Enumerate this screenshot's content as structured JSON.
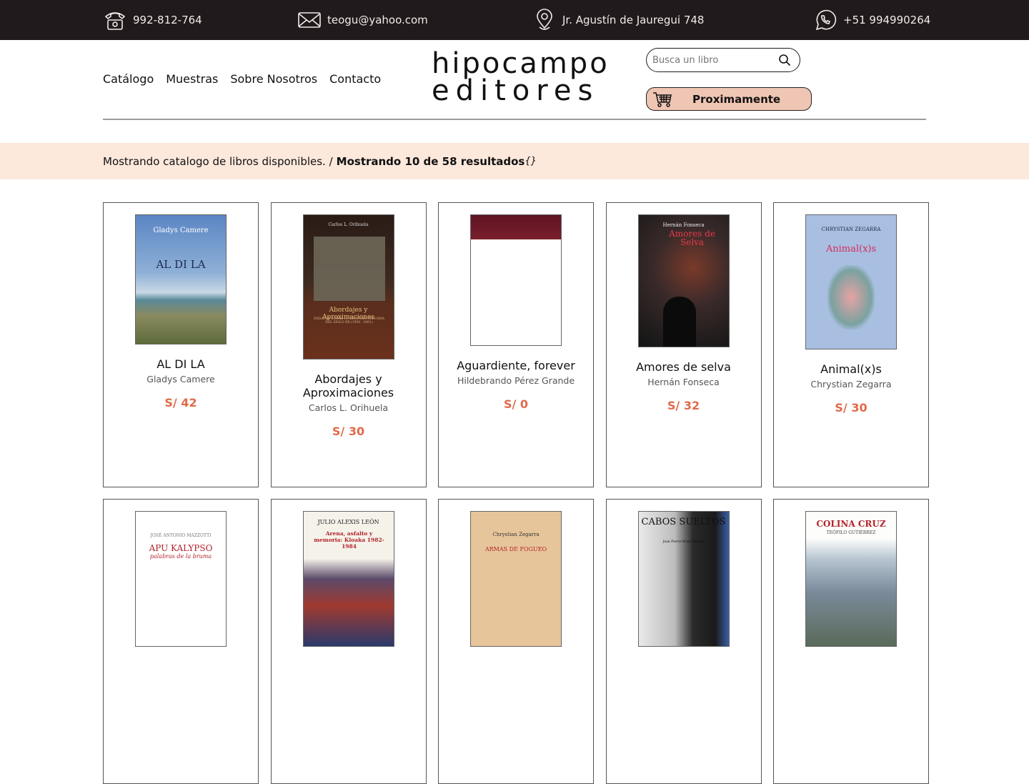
{
  "topbar": {
    "phone": "992-812-764",
    "email": "teogu@yahoo.com",
    "address": "Jr. Agustín de Jauregui 748",
    "whatsapp": "+51 994990264"
  },
  "nav": {
    "items": [
      "Catálogo",
      "Muestras",
      "Sobre Nosotros",
      "Contacto"
    ]
  },
  "logo": {
    "line1": "hipocampo",
    "line2": "editores"
  },
  "search": {
    "placeholder": "Busca un libro"
  },
  "cart": {
    "label": "Proximamente"
  },
  "strip": {
    "text": "Mostrando catalogo de libros disponibles. /",
    "count": "Mostrando 10 de 58 resultados",
    "suffix": "{}"
  },
  "books": [
    {
      "title": "AL DI LA",
      "author": "Gladys Camere",
      "price": "S/ 42",
      "cover_author": "Gladys Camere",
      "cover_title": "AL DI LA"
    },
    {
      "title": "Abordajes y Aproximaciones",
      "author": "Carlos L. Orihuela",
      "price": "S/ 30",
      "cover_author": "Carlos L. Orihuela",
      "cover_title": "Abordajes y Aproximaciones",
      "cover_sub": "ENSAYOS SOBRE LITERATURA PERUANA DEL SIGLO XX (1950 - 2001)"
    },
    {
      "title": "Aguardiente, forever",
      "author": "Hildebrando Pérez Grande",
      "price": "S/ 0"
    },
    {
      "title": "Amores de selva",
      "author": "Hernán Fonseca",
      "price": "S/ 32",
      "cover_author": "Hernán Fonseca",
      "cover_title": "Amores de Selva"
    },
    {
      "title": "Animal(x)s",
      "author": "Chrystian Zegarra",
      "price": "S/ 30",
      "cover_author": "CHRYSTIAN ZEGARRA",
      "cover_title": "Animal(x)s"
    },
    {
      "cover_author": "JOSÉ ANTONIO MAZZOTTI",
      "cover_title": "APU KALYPSO",
      "cover_sub": "palabras de la bruma"
    },
    {
      "cover_author": "JULIO ALEXIS LEÓN",
      "cover_title": "Arena, asfalto y memoria: Kloaka 1982-1984"
    },
    {
      "cover_author": "Chrystian Zegarra",
      "cover_title": "ARMAS DE FOGUEO"
    },
    {
      "cover_title": "CABOS SUELTOS",
      "cover_author": "Jean Pierre Bravo Zapata"
    },
    {
      "cover_title": "COLINA CRUZ",
      "cover_author": "TEÓFILO GUTIÉRREZ"
    }
  ],
  "colors": {
    "topbar": "#211a1d",
    "accent": "#e06a4a",
    "strip": "#fde8dc",
    "cart": "#efc5b3"
  }
}
